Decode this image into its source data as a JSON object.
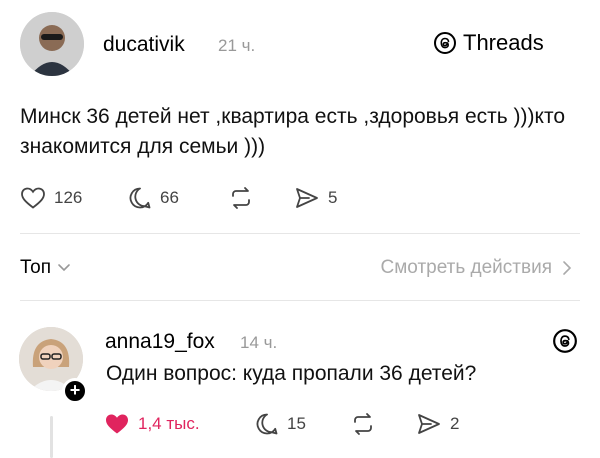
{
  "post": {
    "username": "ducativik",
    "time": "21 ч.",
    "threads_label": "Threads",
    "text": "Минск 36 детей нет ,квартира есть ,здоровья есть )))кто знакомится для семьи )))",
    "likes": "126",
    "comments": "66",
    "shares": "5"
  },
  "filters": {
    "sort_label": "Топ",
    "view_activity_label": "Смотреть действия"
  },
  "reply": {
    "username": "anna19_fox",
    "time": "14 ч.",
    "text": "Один вопрос: куда пропали 36 детей?",
    "likes": "1,4 тыс.",
    "comments": "15",
    "shares": "2"
  },
  "colors": {
    "like_active": "#e0245e",
    "muted": "#999999"
  }
}
